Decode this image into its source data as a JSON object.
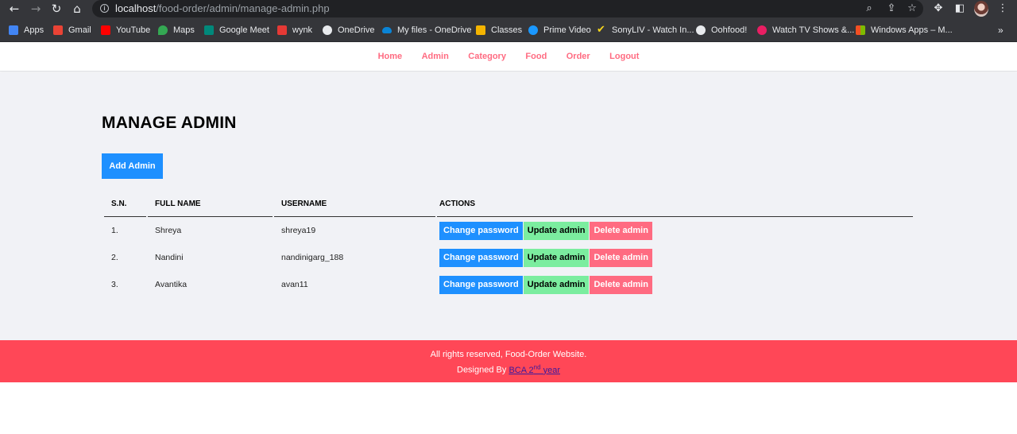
{
  "browser": {
    "url_host": "localhost",
    "url_path": "/food-order/admin/manage-admin.php",
    "bookmarks": [
      {
        "label": "Apps",
        "color": "#4285f4"
      },
      {
        "label": "Gmail",
        "color": "#ea4335"
      },
      {
        "label": "YouTube",
        "color": "#ff0000"
      },
      {
        "label": "Maps",
        "color": "#34a853"
      },
      {
        "label": "Google Meet",
        "color": "#00897b"
      },
      {
        "label": "wynk",
        "color": "#e53935"
      },
      {
        "label": "OneDrive",
        "color": "#e8eaed"
      },
      {
        "label": "My files - OneDrive",
        "color": "#0a84d6"
      },
      {
        "label": "Classes",
        "color": "#f4b400"
      },
      {
        "label": "Prime Video",
        "color": "#1a98ff"
      },
      {
        "label": "SonyLIV - Watch In...",
        "color": "#f9d71c"
      },
      {
        "label": "Oohfood!",
        "color": "#e8eaed"
      },
      {
        "label": "Watch TV Shows &...",
        "color": "#e91e63"
      },
      {
        "label": "Windows Apps – M...",
        "color": "#f25022"
      }
    ]
  },
  "menu": [
    "Home",
    "Admin",
    "Category",
    "Food",
    "Order",
    "Logout"
  ],
  "page": {
    "title": "MANAGE ADMIN",
    "add_button": "Add Admin"
  },
  "table": {
    "headers": [
      "S.N.",
      "FULL NAME",
      "USERNAME",
      "ACTIONS"
    ],
    "rows": [
      {
        "sn": "1.",
        "full_name": "Shreya",
        "username": "shreya19"
      },
      {
        "sn": "2.",
        "full_name": "Nandini",
        "username": "nandinigarg_188"
      },
      {
        "sn": "3.",
        "full_name": "Avantika",
        "username": "avan11"
      }
    ],
    "actions": {
      "change_password": "Change password",
      "update": "Update admin",
      "delete": "Delete admin"
    }
  },
  "footer": {
    "line1": "All rights reserved, Food-Order Website.",
    "designed_by": "Designed By",
    "link_text": "BCA 2",
    "link_sup": "nd",
    "link_suffix": "year"
  },
  "colors": {
    "primary": "#1e90ff",
    "success": "#7bed9f",
    "danger": "#ff6b81",
    "footer": "#ff4757",
    "background": "#f1f2f6"
  }
}
